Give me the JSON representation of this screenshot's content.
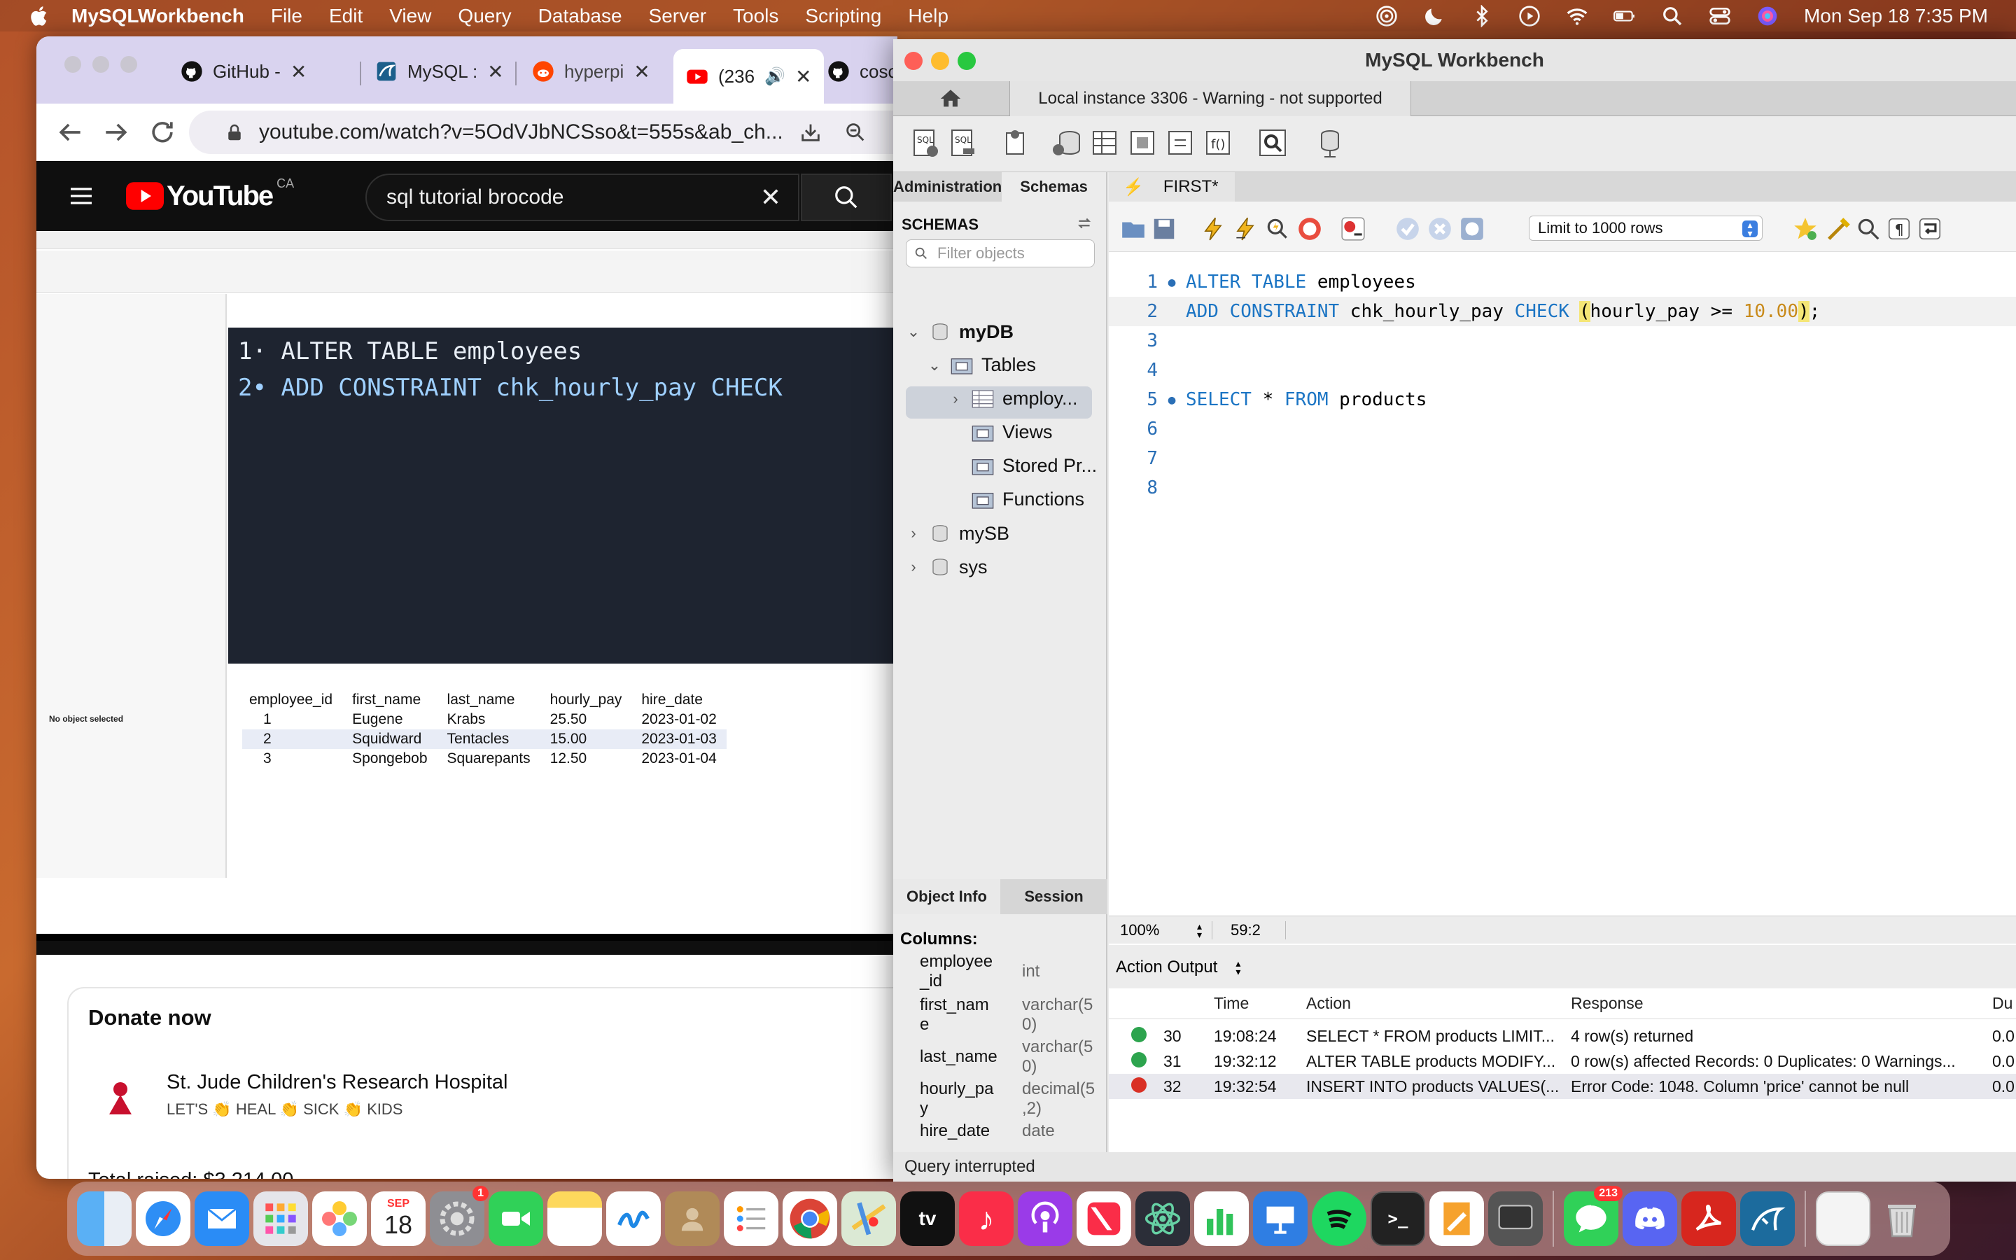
{
  "menubar": {
    "app_name": "MySQLWorkbench",
    "items": [
      "File",
      "Edit",
      "View",
      "Query",
      "Database",
      "Server",
      "Tools",
      "Scripting",
      "Help"
    ],
    "clock": "Mon Sep 18  7:35 PM"
  },
  "chrome": {
    "tabs": [
      {
        "label": "GitHub -"
      },
      {
        "label": "MySQL :"
      },
      {
        "label": "hyperpi"
      },
      {
        "label": "(236"
      },
      {
        "label": "cosc_"
      }
    ],
    "url": "youtube.com/watch?v=5OdVJbNCSso&t=555s&ab_ch..."
  },
  "youtube": {
    "logo_text": "YouTube",
    "region": "CA",
    "search_value": "sql tutorial brocode",
    "video": {
      "code_line1": "1· ALTER TABLE employees",
      "code_line2": "2• ADD CONSTRAINT chk_hourly_pay CHECK",
      "grid_headers": [
        "employee_id",
        "first_name",
        "last_name",
        "hourly_pay",
        "hire_date"
      ],
      "grid_rows": [
        [
          "1",
          "Eugene",
          "Krabs",
          "25.50",
          "2023-01-02"
        ],
        [
          "2",
          "Squidward",
          "Tentacles",
          "15.00",
          "2023-01-03"
        ],
        [
          "3",
          "Spongebob",
          "Squarepants",
          "12.50",
          "2023-01-04"
        ]
      ],
      "no_object": "No object selected"
    },
    "donate": {
      "title": "Donate now",
      "org": "St. Jude Children's Research Hospital",
      "tagline": "LET'S 👏 HEAL 👏 SICK 👏 KIDS",
      "total": "Total raised: $3,214.00"
    }
  },
  "workbench": {
    "title": "MySQL Workbench",
    "connection_tab": "Local instance 3306 - Warning - not supported",
    "sidebar_tabs": [
      "Administration",
      "Schemas"
    ],
    "schemas_header": "SCHEMAS",
    "filter_placeholder": "Filter objects",
    "tree": {
      "db1": "myDB",
      "tables": "Tables",
      "employees": "employ...",
      "views": "Views",
      "procs": "Stored Pr...",
      "functions": "Functions",
      "db2": "mySB",
      "db3": "sys"
    },
    "info_tabs": [
      "Object Info",
      "Session"
    ],
    "columns_label": "Columns:",
    "columns": [
      {
        "name": "employee\n_id",
        "type": "int"
      },
      {
        "name": "first_nam\ne",
        "type": "varchar(5\n0)"
      },
      {
        "name": "last_name",
        "type": "varchar(5\n0)"
      },
      {
        "name": "hourly_pa\ny",
        "type": "decimal(5\n,2)"
      },
      {
        "name": "hire_date",
        "type": "date"
      }
    ],
    "query_tab": "FIRST*",
    "limit": "Limit to 1000 rows",
    "code": {
      "l1_kw": "ALTER TABLE",
      "l1_rest": " employees",
      "l2_kw1": "ADD CONSTRAINT",
      "l2_mid": " chk_hourly_pay ",
      "l2_kw2": "CHECK",
      "l2_par_open": "(",
      "l2_expr": "hourly_pay >= ",
      "l2_num": "10.00",
      "l2_par_close": ")",
      "l2_end": ";",
      "l5_kw1": "SELECT",
      "l5_mid": " * ",
      "l5_kw2": "FROM",
      "l5_rest": " products"
    },
    "line_numbers": [
      "1",
      "2",
      "3",
      "4",
      "5",
      "6",
      "7",
      "8"
    ],
    "zoom": "100%",
    "cursor_pos": "59:2",
    "output_mode": "Action Output",
    "output_headers": {
      "time": "Time",
      "action": "Action",
      "response": "Response",
      "duration": "Du"
    },
    "output_rows": [
      {
        "num": "30",
        "time": "19:08:24",
        "action": "SELECT * FROM products LIMIT...",
        "response": "4 row(s) returned",
        "dur": "0.0",
        "status": "ok"
      },
      {
        "num": "31",
        "time": "19:32:12",
        "action": "ALTER TABLE products MODIFY...",
        "response": "0 row(s) affected Records: 0  Duplicates: 0  Warnings...",
        "dur": "0.0",
        "status": "ok"
      },
      {
        "num": "32",
        "time": "19:32:54",
        "action": "INSERT INTO products VALUES(...",
        "response": "Error Code: 1048. Column 'price' cannot be null",
        "dur": "0.0",
        "status": "error"
      }
    ],
    "status": "Query interrupted"
  },
  "dock": {
    "calendar_month": "SEP",
    "calendar_day": "18",
    "settings_badge": "1",
    "messages_badge": "213",
    "tv_label": "tv"
  },
  "colors": {
    "wb_keyword": "#1c75c4",
    "wb_number": "#c88a1a",
    "yt_red": "#ff0000"
  }
}
